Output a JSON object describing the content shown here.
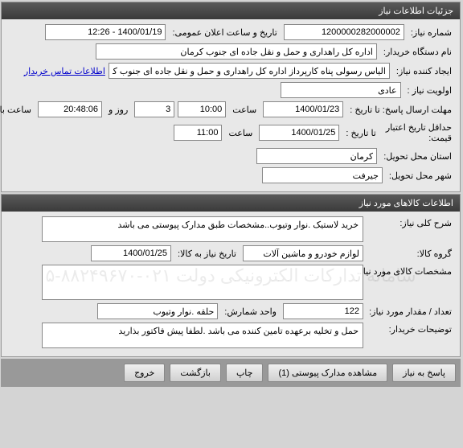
{
  "panel1": {
    "title": "جزئیات اطلاعات نیاز",
    "need_no_label": "شماره نیاز:",
    "need_no": "1200000282000002",
    "ann_time_label": "تاریخ و ساعت اعلان عمومی:",
    "ann_time": "1400/01/19 - 12:26",
    "buyer_label": "نام دستگاه خریدار:",
    "buyer": "اداره کل راهداری و حمل و نقل جاده ای جنوب کرمان",
    "creator_label": "ایجاد کننده نیاز:",
    "creator": "الیاس رسولی پناه کارپرداز اداره کل راهداری و حمل و نقل جاده ای جنوب کرمان",
    "contact_link": "اطلاعات تماس خریدار",
    "priority_label": "اولویت نیاز :",
    "priority": "عادی",
    "deadline_label": "مهلت ارسال پاسخ:  تا تاریخ :",
    "deadline_date": "1400/01/23",
    "saat": "ساعت",
    "deadline_time": "10:00",
    "days": "3",
    "days_and": "روز و",
    "remaining": "20:48:06",
    "remaining_label": "ساعت باقی مانده",
    "min_valid_label": "حداقل تاریخ اعتبار",
    "min_valid_label2": "قیمت:",
    "min_valid_sub": "تا تاریخ :",
    "min_valid_date": "1400/01/25",
    "min_valid_time": "11:00",
    "province_label": "استان محل تحویل:",
    "province": "کرمان",
    "city_label": "شهر محل تحویل:",
    "city": "جیرفت"
  },
  "panel2": {
    "title": "اطلاعات کالاهای مورد نیاز",
    "desc_label": "شرح کلی نیاز:",
    "desc": "خرید لاستیک .نوار وتیوب..مشخصات طبق مدارک پیوستی می باشد",
    "group_label": "گروه کالا:",
    "group": "لوازم خودرو و ماشین آلات",
    "need_date_label": "تاریخ نیاز به کالا:",
    "need_date": "1400/01/25",
    "spec_label": "مشخصات کالای مورد نیاز:",
    "spec": "",
    "qty_label": "تعداد / مقدار مورد نیاز:",
    "qty": "122",
    "unit_label": "واحد شمارش:",
    "unit": "حلقه .نوار وتیوب",
    "notes_label": "توضیحات خریدار:",
    "notes": "حمل و تخلیه برعهده تامین کننده می باشد .لطفا پیش فاکتور بذارید",
    "watermark": "سامانه تدارکات الکترونیکی دولت\n۰۲۱-۸۸۲۴۹۶۷۰-۵"
  },
  "buttons": {
    "reply": "پاسخ به نیاز",
    "view_attach": "مشاهده مدارک پیوستی (1)",
    "print": "چاپ",
    "back": "بازگشت",
    "exit": "خروج"
  }
}
